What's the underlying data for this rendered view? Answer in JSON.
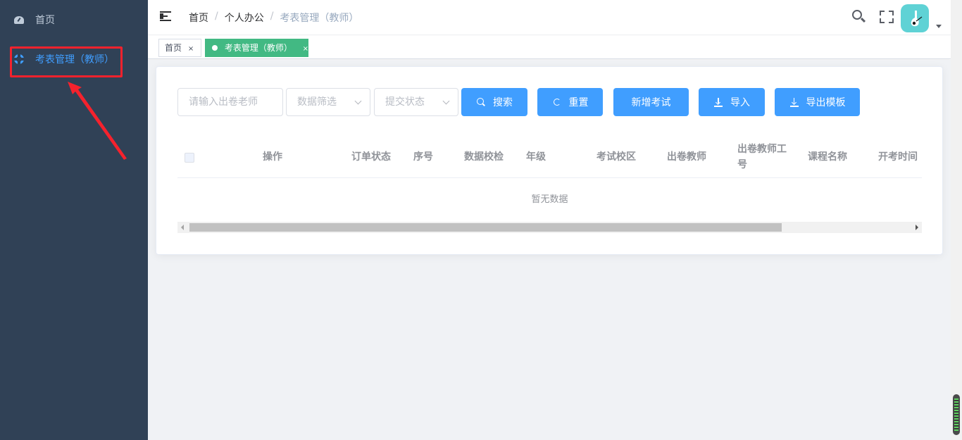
{
  "sidebar": {
    "items": [
      {
        "label": "首页",
        "icon": "dashboard-icon",
        "active": false
      },
      {
        "label": "考表管理（教师）",
        "icon": "target-icon",
        "active": true
      }
    ],
    "background": "#304156",
    "active_color": "#409eff"
  },
  "header": {
    "breadcrumb": [
      "首页",
      "个人办公",
      "考表管理（教师）"
    ],
    "breadcrumb_sep": "/"
  },
  "tags": [
    {
      "label": "首页",
      "close": "×",
      "active": false
    },
    {
      "label": "考表管理（教师）",
      "close": "×",
      "active": true
    }
  ],
  "filters": {
    "teacher_placeholder": "请输入出卷老师",
    "data_filter_placeholder": "数据筛选",
    "status_placeholder": "提交状态"
  },
  "buttons": {
    "search": "搜索",
    "reset": "重置",
    "add": "新增考试",
    "import": "导入",
    "export_template": "导出模板"
  },
  "table": {
    "columns": [
      "操作",
      "订单状态",
      "序号",
      "数据校检",
      "年级",
      "考试校区",
      "出卷教师",
      "出卷教师工号",
      "课程名称",
      "开考时间"
    ],
    "empty_text": "暂无数据"
  },
  "colors": {
    "primary": "#409eff",
    "tag_active": "#42b983",
    "annotation": "#f5222d"
  }
}
